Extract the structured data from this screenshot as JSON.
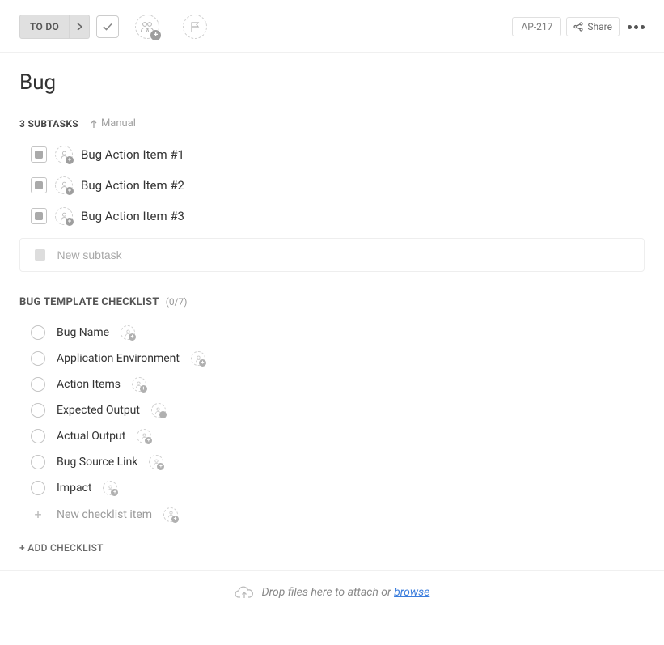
{
  "toolbar": {
    "status": "TO DO",
    "task_id": "AP-217",
    "share_label": "Share"
  },
  "title": "Bug",
  "subtasks": {
    "header": "3 SUBTASKS",
    "sort_label": "Manual",
    "items": [
      {
        "label": "Bug Action Item #1"
      },
      {
        "label": "Bug Action Item #2"
      },
      {
        "label": "Bug Action Item #3"
      }
    ],
    "new_placeholder": "New subtask"
  },
  "checklist": {
    "title": "BUG TEMPLATE CHECKLIST",
    "count": "(0/7)",
    "items": [
      {
        "label": "Bug Name"
      },
      {
        "label": "Application Environment"
      },
      {
        "label": "Action Items"
      },
      {
        "label": "Expected Output"
      },
      {
        "label": "Actual Output"
      },
      {
        "label": "Bug Source Link"
      },
      {
        "label": "Impact"
      }
    ],
    "new_item_label": "New checklist item",
    "add_label": "+ ADD CHECKLIST"
  },
  "dropzone": {
    "prefix": "Drop files here to attach or ",
    "browse": "browse"
  }
}
